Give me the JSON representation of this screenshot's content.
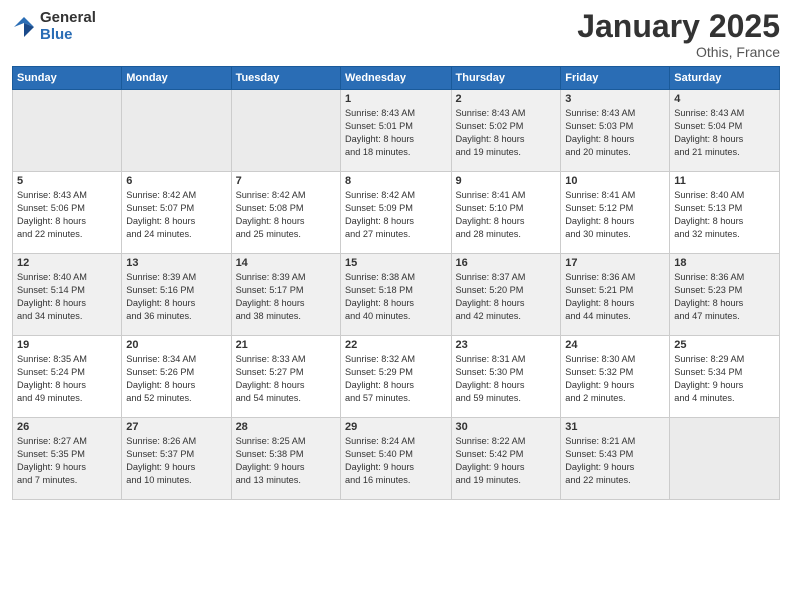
{
  "logo": {
    "general": "General",
    "blue": "Blue"
  },
  "header": {
    "month": "January 2025",
    "location": "Othis, France"
  },
  "weekdays": [
    "Sunday",
    "Monday",
    "Tuesday",
    "Wednesday",
    "Thursday",
    "Friday",
    "Saturday"
  ],
  "weeks": [
    [
      {
        "day": "",
        "info": ""
      },
      {
        "day": "",
        "info": ""
      },
      {
        "day": "",
        "info": ""
      },
      {
        "day": "1",
        "info": "Sunrise: 8:43 AM\nSunset: 5:01 PM\nDaylight: 8 hours\nand 18 minutes."
      },
      {
        "day": "2",
        "info": "Sunrise: 8:43 AM\nSunset: 5:02 PM\nDaylight: 8 hours\nand 19 minutes."
      },
      {
        "day": "3",
        "info": "Sunrise: 8:43 AM\nSunset: 5:03 PM\nDaylight: 8 hours\nand 20 minutes."
      },
      {
        "day": "4",
        "info": "Sunrise: 8:43 AM\nSunset: 5:04 PM\nDaylight: 8 hours\nand 21 minutes."
      }
    ],
    [
      {
        "day": "5",
        "info": "Sunrise: 8:43 AM\nSunset: 5:06 PM\nDaylight: 8 hours\nand 22 minutes."
      },
      {
        "day": "6",
        "info": "Sunrise: 8:42 AM\nSunset: 5:07 PM\nDaylight: 8 hours\nand 24 minutes."
      },
      {
        "day": "7",
        "info": "Sunrise: 8:42 AM\nSunset: 5:08 PM\nDaylight: 8 hours\nand 25 minutes."
      },
      {
        "day": "8",
        "info": "Sunrise: 8:42 AM\nSunset: 5:09 PM\nDaylight: 8 hours\nand 27 minutes."
      },
      {
        "day": "9",
        "info": "Sunrise: 8:41 AM\nSunset: 5:10 PM\nDaylight: 8 hours\nand 28 minutes."
      },
      {
        "day": "10",
        "info": "Sunrise: 8:41 AM\nSunset: 5:12 PM\nDaylight: 8 hours\nand 30 minutes."
      },
      {
        "day": "11",
        "info": "Sunrise: 8:40 AM\nSunset: 5:13 PM\nDaylight: 8 hours\nand 32 minutes."
      }
    ],
    [
      {
        "day": "12",
        "info": "Sunrise: 8:40 AM\nSunset: 5:14 PM\nDaylight: 8 hours\nand 34 minutes."
      },
      {
        "day": "13",
        "info": "Sunrise: 8:39 AM\nSunset: 5:16 PM\nDaylight: 8 hours\nand 36 minutes."
      },
      {
        "day": "14",
        "info": "Sunrise: 8:39 AM\nSunset: 5:17 PM\nDaylight: 8 hours\nand 38 minutes."
      },
      {
        "day": "15",
        "info": "Sunrise: 8:38 AM\nSunset: 5:18 PM\nDaylight: 8 hours\nand 40 minutes."
      },
      {
        "day": "16",
        "info": "Sunrise: 8:37 AM\nSunset: 5:20 PM\nDaylight: 8 hours\nand 42 minutes."
      },
      {
        "day": "17",
        "info": "Sunrise: 8:36 AM\nSunset: 5:21 PM\nDaylight: 8 hours\nand 44 minutes."
      },
      {
        "day": "18",
        "info": "Sunrise: 8:36 AM\nSunset: 5:23 PM\nDaylight: 8 hours\nand 47 minutes."
      }
    ],
    [
      {
        "day": "19",
        "info": "Sunrise: 8:35 AM\nSunset: 5:24 PM\nDaylight: 8 hours\nand 49 minutes."
      },
      {
        "day": "20",
        "info": "Sunrise: 8:34 AM\nSunset: 5:26 PM\nDaylight: 8 hours\nand 52 minutes."
      },
      {
        "day": "21",
        "info": "Sunrise: 8:33 AM\nSunset: 5:27 PM\nDaylight: 8 hours\nand 54 minutes."
      },
      {
        "day": "22",
        "info": "Sunrise: 8:32 AM\nSunset: 5:29 PM\nDaylight: 8 hours\nand 57 minutes."
      },
      {
        "day": "23",
        "info": "Sunrise: 8:31 AM\nSunset: 5:30 PM\nDaylight: 8 hours\nand 59 minutes."
      },
      {
        "day": "24",
        "info": "Sunrise: 8:30 AM\nSunset: 5:32 PM\nDaylight: 9 hours\nand 2 minutes."
      },
      {
        "day": "25",
        "info": "Sunrise: 8:29 AM\nSunset: 5:34 PM\nDaylight: 9 hours\nand 4 minutes."
      }
    ],
    [
      {
        "day": "26",
        "info": "Sunrise: 8:27 AM\nSunset: 5:35 PM\nDaylight: 9 hours\nand 7 minutes."
      },
      {
        "day": "27",
        "info": "Sunrise: 8:26 AM\nSunset: 5:37 PM\nDaylight: 9 hours\nand 10 minutes."
      },
      {
        "day": "28",
        "info": "Sunrise: 8:25 AM\nSunset: 5:38 PM\nDaylight: 9 hours\nand 13 minutes."
      },
      {
        "day": "29",
        "info": "Sunrise: 8:24 AM\nSunset: 5:40 PM\nDaylight: 9 hours\nand 16 minutes."
      },
      {
        "day": "30",
        "info": "Sunrise: 8:22 AM\nSunset: 5:42 PM\nDaylight: 9 hours\nand 19 minutes."
      },
      {
        "day": "31",
        "info": "Sunrise: 8:21 AM\nSunset: 5:43 PM\nDaylight: 9 hours\nand 22 minutes."
      },
      {
        "day": "",
        "info": ""
      }
    ]
  ]
}
